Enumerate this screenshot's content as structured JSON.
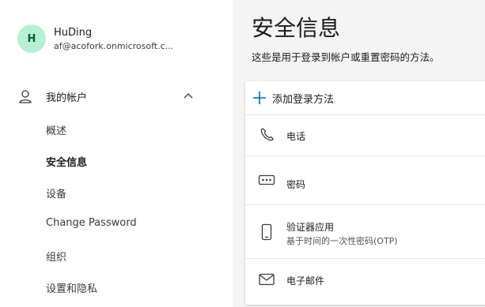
{
  "user": {
    "initial": "H",
    "name": "HuDing",
    "email": "af@acofork.onmicrosoft.c..."
  },
  "sidebar": {
    "account_label": "我的帐户",
    "items": [
      {
        "label": "概述",
        "active": false
      },
      {
        "label": "安全信息",
        "active": true
      },
      {
        "label": "设备",
        "active": false
      },
      {
        "label": "Change Password",
        "active": false
      },
      {
        "label": "组织",
        "active": false
      },
      {
        "label": "设置和隐私",
        "active": false
      }
    ]
  },
  "main": {
    "title": "安全信息",
    "subtitle": "这些是用于登录到帐户或重置密码的方法。",
    "add_method_label": "添加登录方法",
    "methods": [
      {
        "icon": "phone-icon",
        "name": "电话"
      },
      {
        "icon": "password-icon",
        "name": "密码"
      },
      {
        "icon": "authenticator-app-icon",
        "name": "验证器应用",
        "description": "基于时间的一次性密码(OTP)"
      },
      {
        "icon": "email-icon",
        "name": "电子邮件"
      }
    ]
  },
  "colors": {
    "avatar_bg": "#b6efd4",
    "avatar_text": "#0b5a35",
    "accent": "#0067b8",
    "page_bg": "#f4f4f4"
  }
}
